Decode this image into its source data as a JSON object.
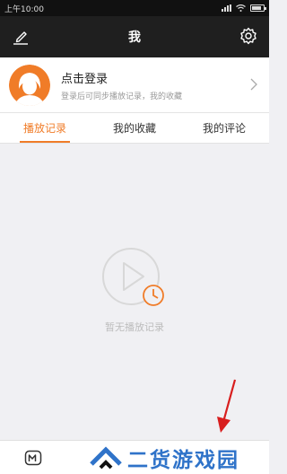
{
  "status_bar": {
    "time": "上午10:00"
  },
  "header": {
    "title": "我",
    "left_icon": "edit-icon",
    "right_icon": "gear-icon"
  },
  "profile": {
    "title": "点击登录",
    "subtitle": "登录后可同步播放记录，我的收藏"
  },
  "tabs": [
    {
      "label": "播放记录",
      "active": true
    },
    {
      "label": "我的收藏",
      "active": false
    },
    {
      "label": "我的评论",
      "active": false
    }
  ],
  "empty_state": {
    "text": "暂无播放记录",
    "icon": "play-clock-icon"
  },
  "watermark": {
    "text": "二货游戏园"
  },
  "colors": {
    "accent": "#f07c28",
    "header_bg": "#1f1f1f",
    "page_bg": "#f0f0f3",
    "annotation": "#d81e1e",
    "watermark": "#2f73c9"
  }
}
